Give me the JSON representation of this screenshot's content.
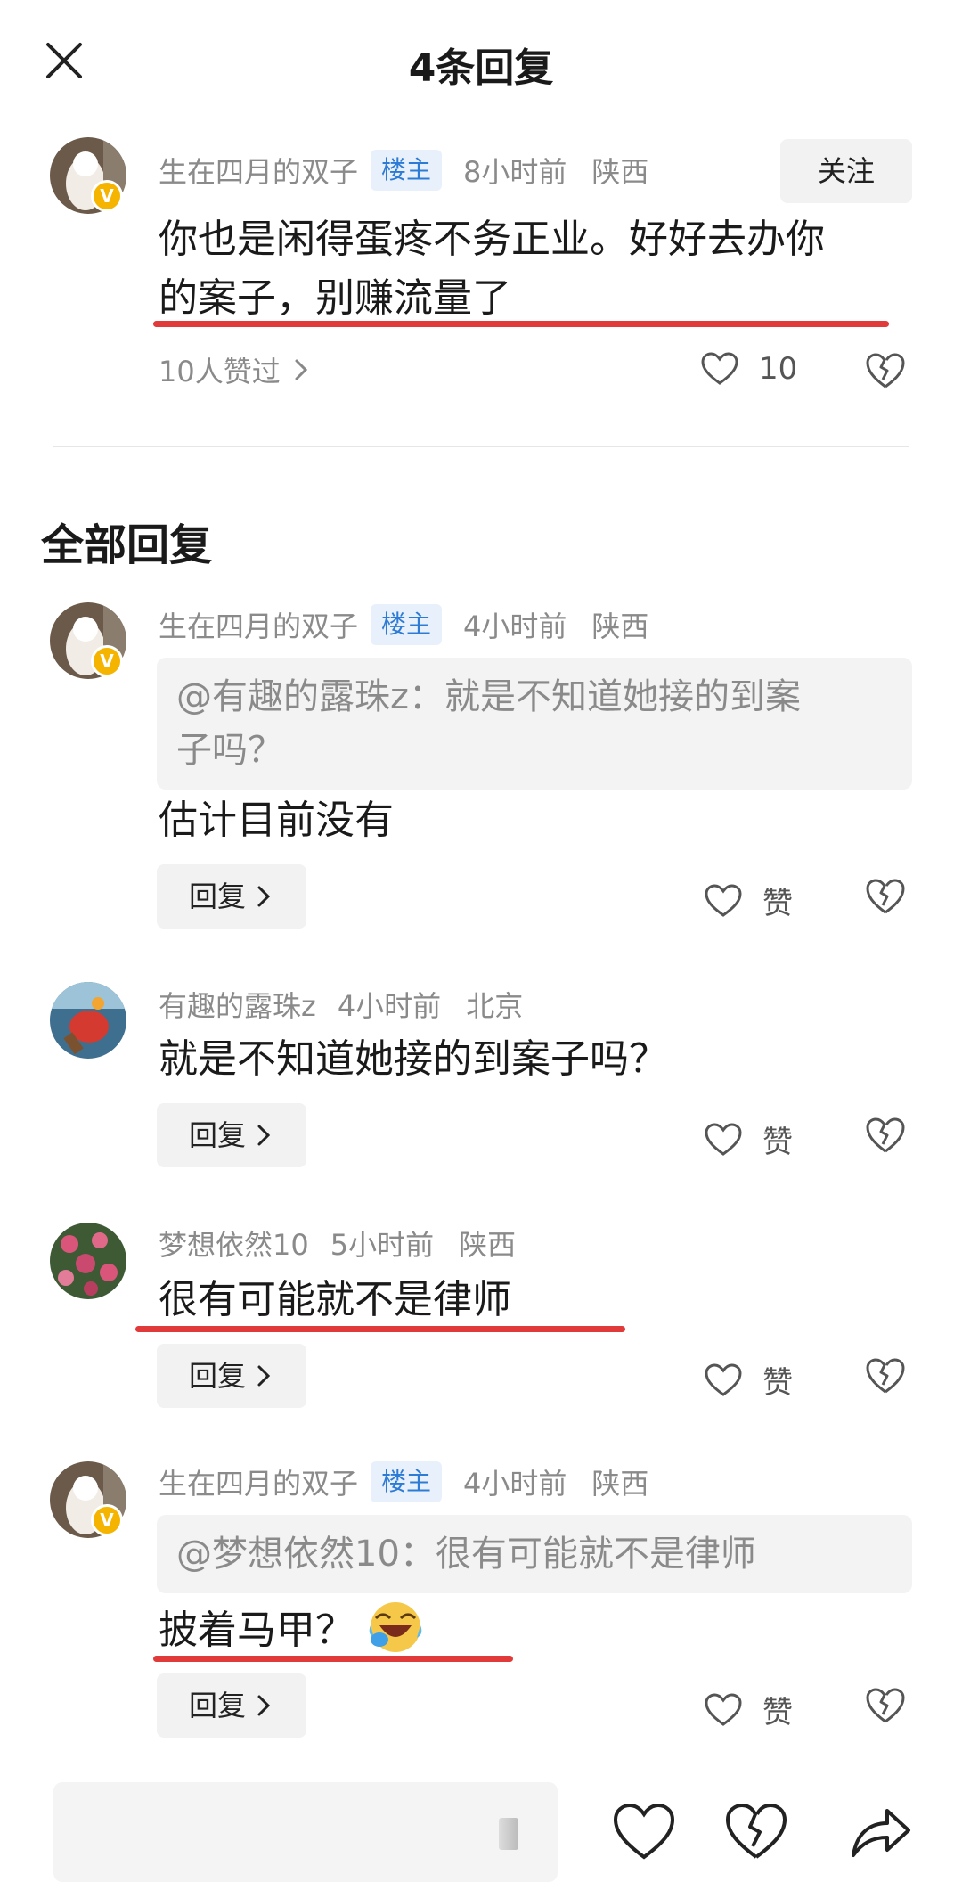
{
  "header": {
    "title": "4条回复"
  },
  "main_comment": {
    "name": "生在四月的双子",
    "tag": "楼主",
    "time": "8小时前",
    "location": "陕西",
    "follow_label": "关注",
    "text_line1": "你也是闲得蛋疼不务正业。好好去办你",
    "text_line2": "的案子，别赚流量了",
    "likes_summary": "10人赞过",
    "like_count": "10"
  },
  "section_title": "全部回复",
  "replies": [
    {
      "name": "生在四月的双子",
      "tag": "楼主",
      "time": "4小时前",
      "location": "陕西",
      "quote_line1": "@有趣的露珠z：就是不知道她接的到案",
      "quote_line2": "子吗？",
      "text": "估计目前没有",
      "reply_label": "回复",
      "like_label": "赞"
    },
    {
      "name": "有趣的露珠z",
      "time": "4小时前",
      "location": "北京",
      "text": "就是不知道她接的到案子吗？",
      "reply_label": "回复",
      "like_label": "赞"
    },
    {
      "name": "梦想依然10",
      "time": "5小时前",
      "location": "陕西",
      "text": "很有可能就不是律师",
      "reply_label": "回复",
      "like_label": "赞"
    },
    {
      "name": "生在四月的双子",
      "tag": "楼主",
      "time": "4小时前",
      "location": "陕西",
      "quote_line1": "@梦想依然10：很有可能就不是律师",
      "text": "披着马甲？",
      "emoji": "laughing-crying-emoji",
      "reply_label": "回复",
      "like_label": "赞"
    }
  ],
  "icons": {
    "close": "close-icon",
    "heart": "heart-icon",
    "broken_heart": "broken-heart-icon",
    "share": "share-icon",
    "chevron": "chevron-right-icon",
    "verified": "verified-badge-icon"
  },
  "verified_badge": "V",
  "colors": {
    "tag_bg": "#e8f1fb",
    "tag_text": "#2e7bd6",
    "underline": "#e03a3a",
    "verified": "#f5b400"
  }
}
